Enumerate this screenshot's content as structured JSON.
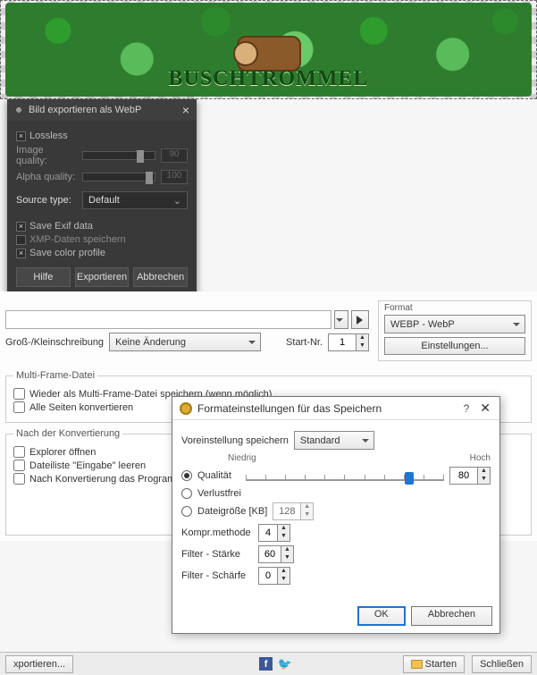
{
  "banner": {
    "text": "BUSCHTROMMEL"
  },
  "gimp": {
    "title": "Bild exportieren als WebP",
    "lossless": "Lossless",
    "image_quality_label": "Image quality:",
    "image_quality_value": "90",
    "alpha_quality_label": "Alpha quality:",
    "alpha_quality_value": "100",
    "source_type_label": "Source type:",
    "source_type_value": "Default",
    "save_exif": "Save Exif data",
    "xmp": "XMP-Daten speichern",
    "color_profile": "Save color profile",
    "help": "Hilfe",
    "export": "Exportieren",
    "cancel": "Abbrechen"
  },
  "host": {
    "case_label": "Groß-/Kleinschreibung",
    "case_value": "Keine Änderung",
    "start_nr_label": "Start-Nr.",
    "start_nr_value": "1",
    "format_label": "Format",
    "format_value": "WEBP - WebP",
    "settings_btn": "Einstellungen...",
    "multi_legend": "Multi-Frame-Datei",
    "multi_save": "Wieder als Multi-Frame-Datei speichern (wenn möglich)",
    "multi_all": "Alle Seiten konvertieren",
    "after_legend": "Nach der Konvertierung",
    "after_explorer": "Explorer öffnen",
    "after_clear": "Dateiliste \"Eingabe\" leeren",
    "after_quit": "Nach Konvertierung das Programm beenden"
  },
  "modal": {
    "title": "Formateinstellungen für das Speichern",
    "preset_label": "Voreinstellung speichern",
    "preset_value": "Standard",
    "axis_low": "Niedrig",
    "axis_high": "Hoch",
    "quality_label": "Qualität",
    "quality_value": "80",
    "lossless_label": "Verlustfrei",
    "filesize_label": "Dateigröße [KB]",
    "filesize_value": "128",
    "compr_label": "Kompr.methode",
    "compr_value": "4",
    "filter_strength_label": "Filter - Stärke",
    "filter_strength_value": "60",
    "filter_sharp_label": "Filter - Schärfe",
    "filter_sharp_value": "0",
    "ok": "OK",
    "cancel": "Abbrechen"
  },
  "footer": {
    "export": "xportieren...",
    "start": "Starten",
    "close": "Schließen"
  }
}
